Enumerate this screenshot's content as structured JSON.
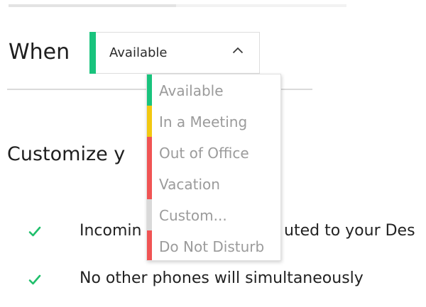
{
  "when": {
    "label": "When",
    "selected_value": "Available",
    "selected_color": "#19c37d",
    "chevron_icon": "chevron-up-icon"
  },
  "status_options": [
    {
      "label": "Available",
      "color": "#19c37d"
    },
    {
      "label": "In a Meeting",
      "color": "#f2c811"
    },
    {
      "label": "Out of Office",
      "color": "#f05454"
    },
    {
      "label": "Vacation",
      "color": "#f05454"
    },
    {
      "label": "Custom...",
      "color": "#d9d9d9"
    },
    {
      "label": "Do Not Disturb",
      "color": "#f05454"
    }
  ],
  "customize": {
    "title_visible": "Customize y",
    "check_icon": "checkmark-icon",
    "check_color": "#1fbf6b",
    "features": [
      {
        "text": "Incomin"
      },
      {
        "text": "uted to your Des"
      },
      {
        "text": "No other phones will simultaneously"
      }
    ]
  }
}
